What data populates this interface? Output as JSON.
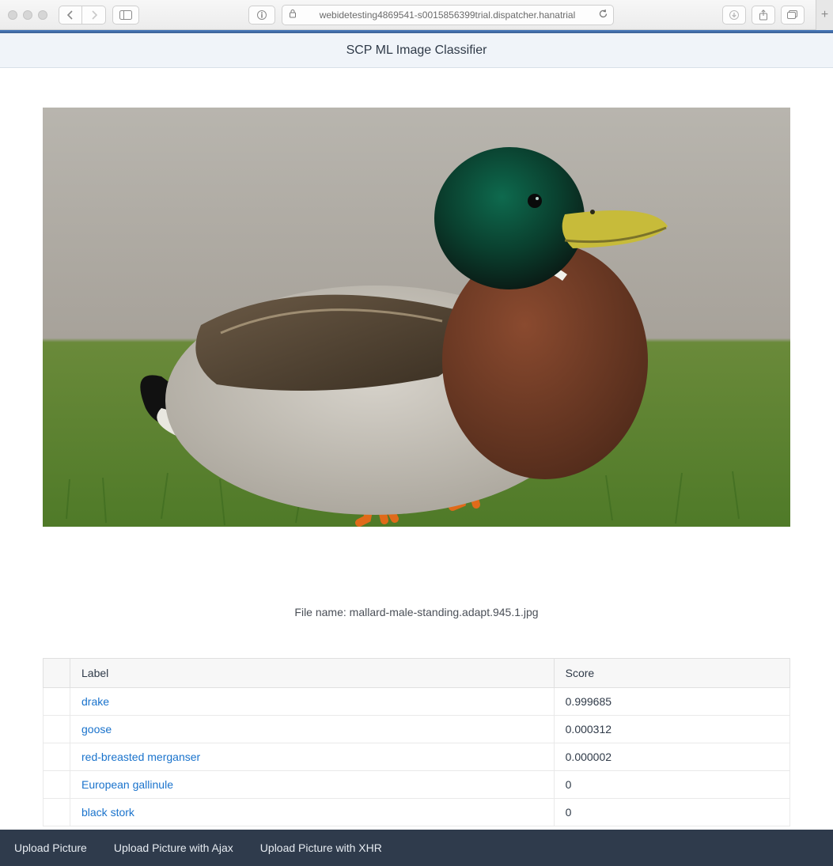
{
  "browser": {
    "url_display": "webidetesting4869541-s0015856399trial.dispatcher.hanatrial"
  },
  "header": {
    "title": "SCP ML Image Classifier"
  },
  "file": {
    "label_prefix": "File name: ",
    "name": "mallard-male-standing.adapt.945.1.jpg"
  },
  "table": {
    "headers": {
      "label": "Label",
      "score": "Score"
    },
    "rows": [
      {
        "label": "drake",
        "score": "0.999685"
      },
      {
        "label": "goose",
        "score": "0.000312"
      },
      {
        "label": "red-breasted merganser",
        "score": "0.000002"
      },
      {
        "label": "European gallinule",
        "score": "0"
      },
      {
        "label": "black stork",
        "score": "0"
      }
    ]
  },
  "footer": {
    "btn1": "Upload Picture",
    "btn2": "Upload Picture with Ajax",
    "btn3": "Upload Picture with XHR"
  }
}
